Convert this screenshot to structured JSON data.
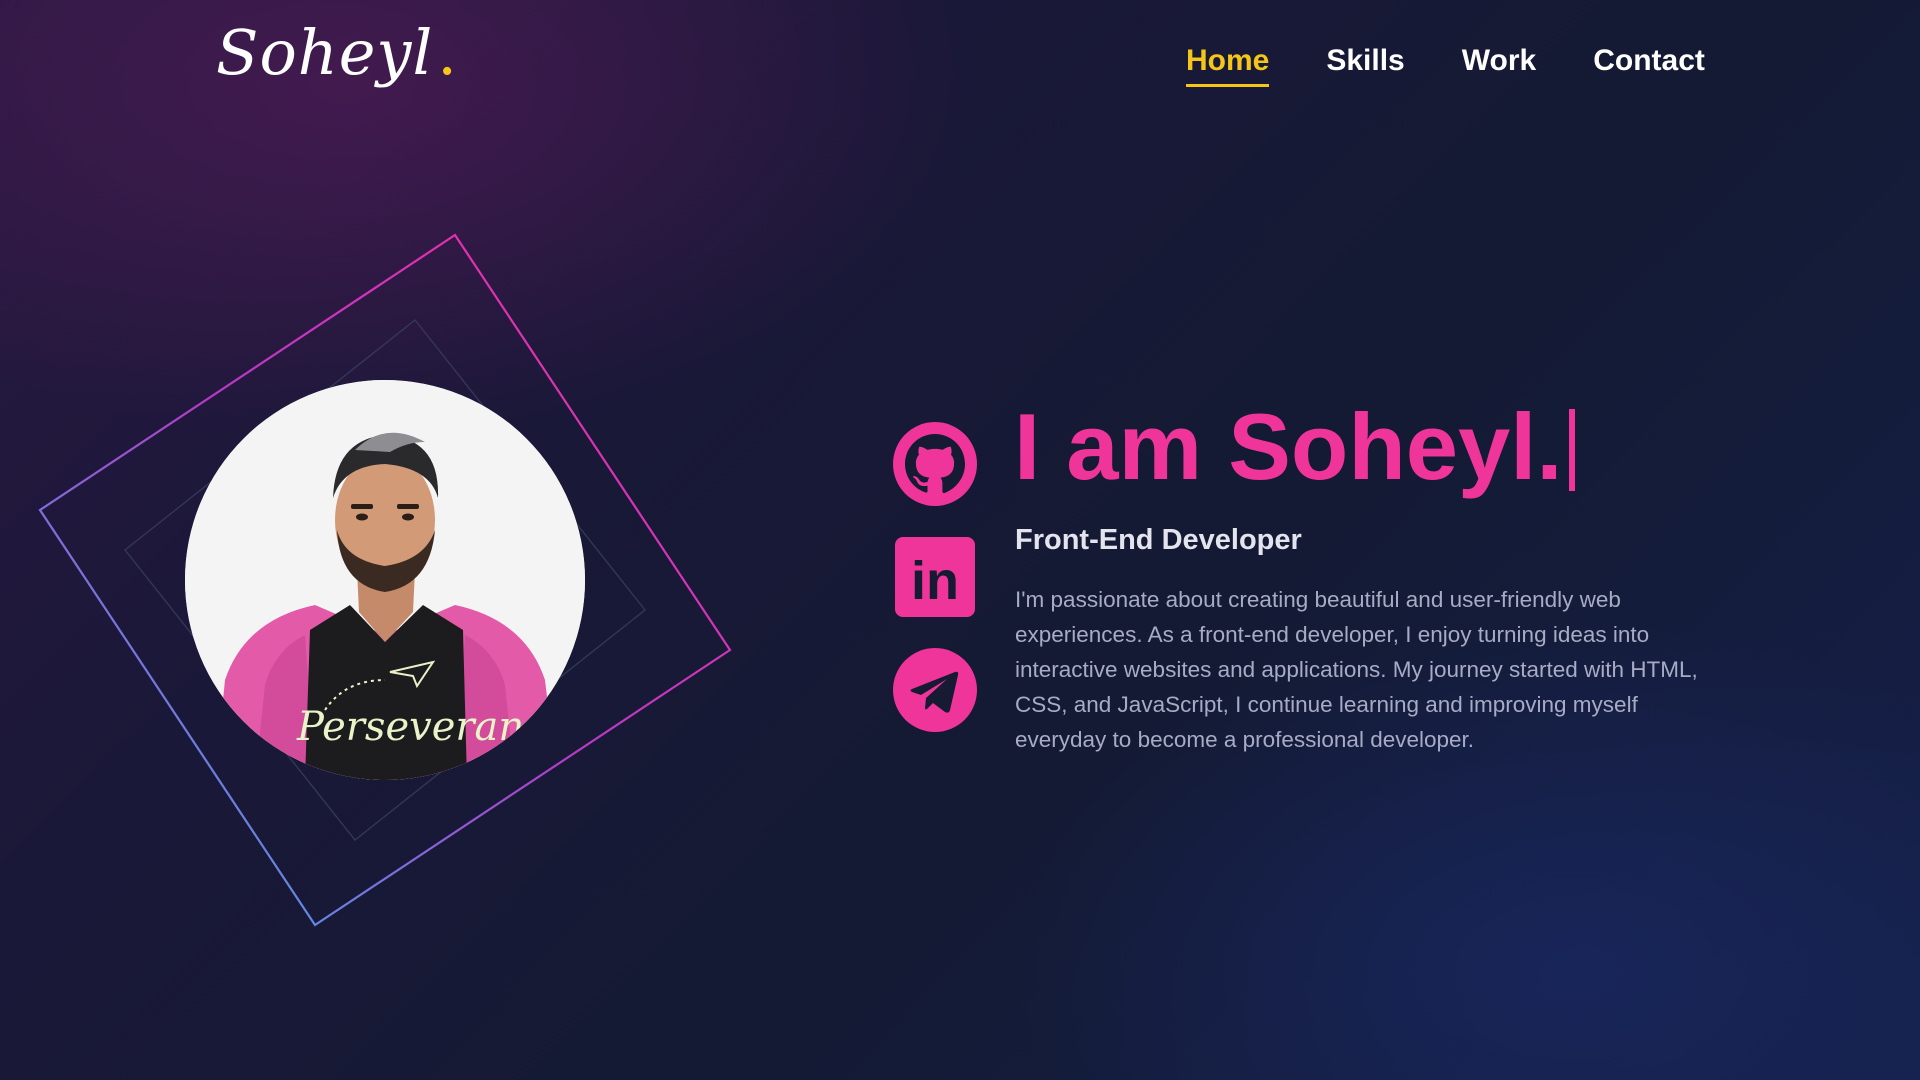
{
  "brand": {
    "logo_text": "Soheyl",
    "logo_dot": "."
  },
  "nav": {
    "items": [
      {
        "label": "Home",
        "active": true
      },
      {
        "label": "Skills",
        "active": false
      },
      {
        "label": "Work",
        "active": false
      },
      {
        "label": "Contact",
        "active": false
      }
    ]
  },
  "hero": {
    "title": "I am Soheyl.",
    "role": "Front-End Developer",
    "bio": "I'm passionate about creating beautiful and user-friendly web experiences. As a front-end developer, I enjoy turning ideas into interactive websites and applications. My journey started with HTML, CSS, and JavaScript, I continue learning and improving myself everyday to become a professional developer.",
    "photo_shirt_text": "Perseveran"
  },
  "socials": [
    {
      "name": "GitHub",
      "icon": "github-icon"
    },
    {
      "name": "LinkedIn",
      "icon": "linkedin-icon",
      "glyph": "in"
    },
    {
      "name": "Telegram",
      "icon": "telegram-icon"
    }
  ],
  "colors": {
    "accent_pink": "#f0359a",
    "accent_yellow": "#f5c518",
    "frame_gradient_start": "#ff2a9d",
    "frame_gradient_end": "#36b8f4",
    "background_dark": "#151a33",
    "text_muted": "#a7abc4"
  }
}
